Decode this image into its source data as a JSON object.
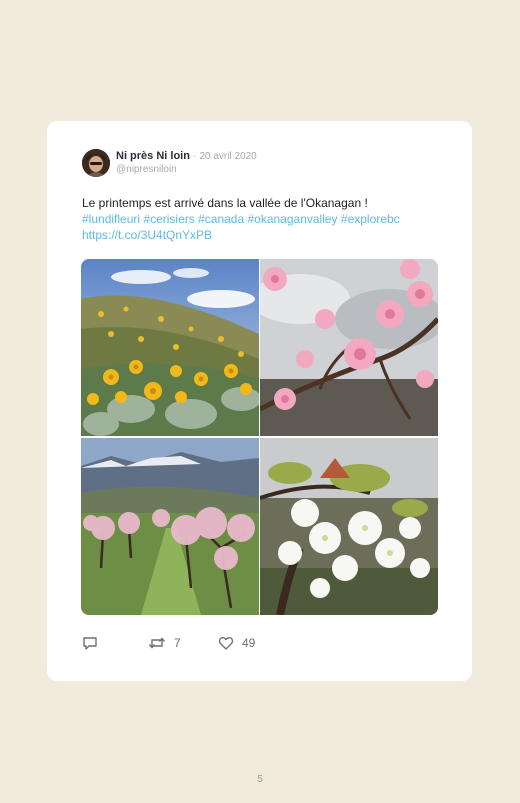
{
  "tweet": {
    "author_name": "Ni près Ni loin",
    "date": "20 avril 2020",
    "handle": "@nipresniloin",
    "text_line1": "Le printemps est arrivé dans la vallée de l'Okanagan !",
    "hashtags": [
      "#lundifleuri",
      "#cerisiers",
      "#canada",
      "#okanaganvalley",
      "#explorebc"
    ],
    "link": "https://t.co/3U4tQnYxPB",
    "photos": [
      {
        "subject": "yellow balsamroot wildflowers on hillside"
      },
      {
        "subject": "pink peach blossoms close-up"
      },
      {
        "subject": "orchard with pink blossoming trees and mountains"
      },
      {
        "subject": "white cherry blossoms close-up"
      }
    ],
    "actions": {
      "reply_icon": "speech-bubble-icon",
      "retweet_icon": "retweet-icon",
      "retweet_count": "7",
      "like_icon": "heart-icon",
      "like_count": "49"
    }
  },
  "page": {
    "number": "5"
  },
  "colors": {
    "background": "#f1ebdd",
    "card": "#ffffff",
    "link": "#5eb8e6",
    "name": "#2b2f3b",
    "muted": "#a4a8b0"
  }
}
